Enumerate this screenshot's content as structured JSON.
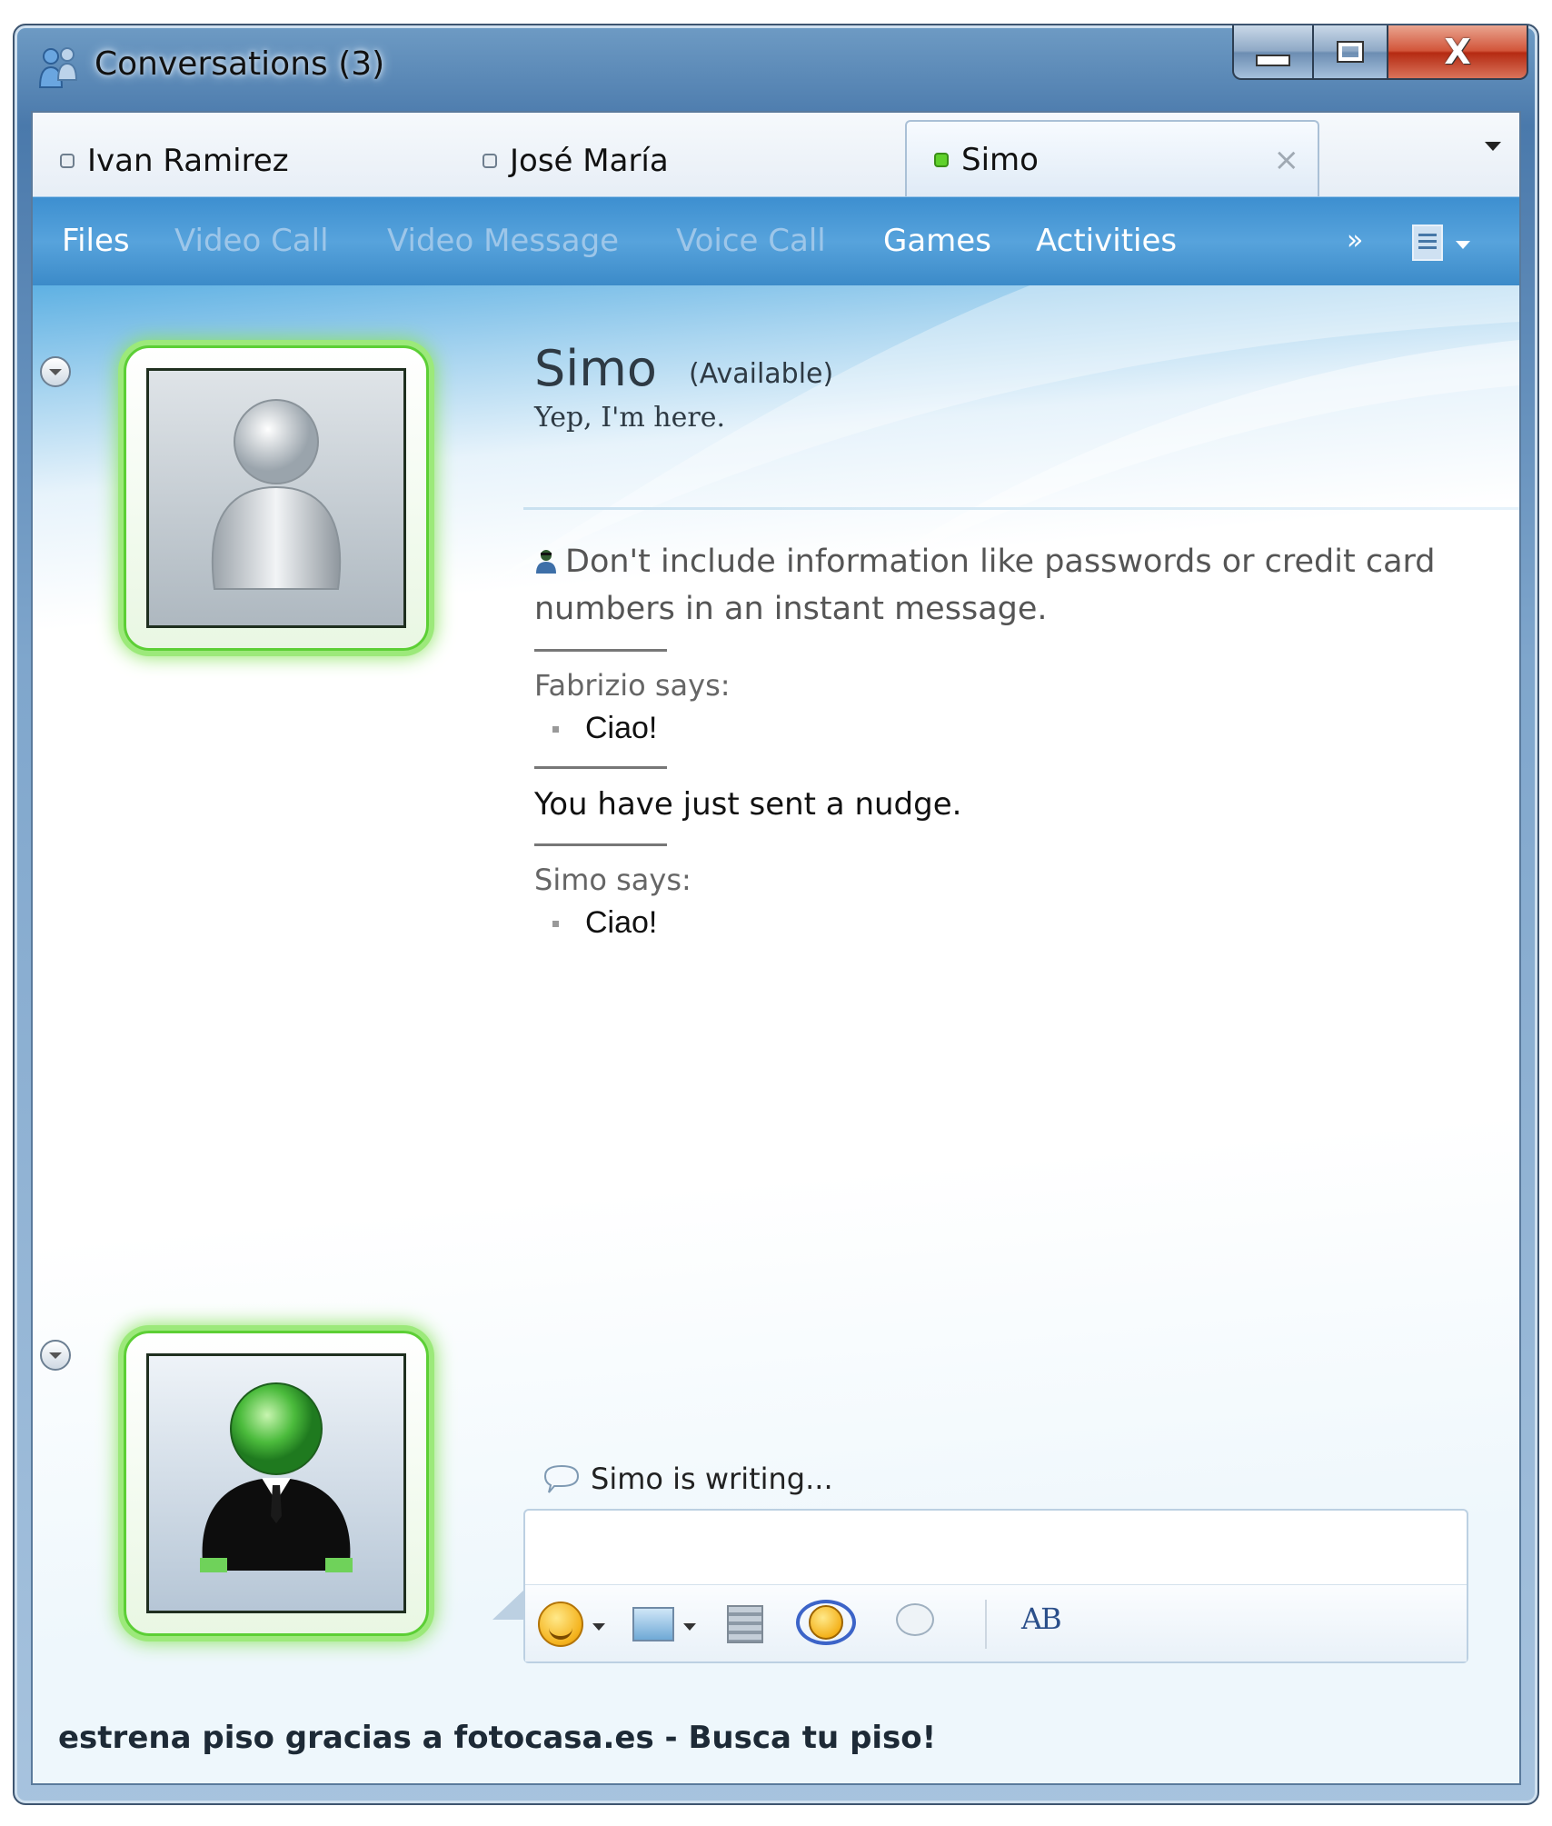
{
  "window": {
    "title": "Conversations (3)",
    "close_label": "X"
  },
  "tabs": [
    {
      "label": "Ivan Ramirez",
      "status": "offline"
    },
    {
      "label": "José María",
      "status": "offline"
    },
    {
      "label": "Simo",
      "status": "available",
      "active": true,
      "close_label": "×"
    }
  ],
  "toolbar": {
    "files": "Files",
    "video_call": "Video Call",
    "video_message": "Video Message",
    "voice_call": "Voice Call",
    "games": "Games",
    "activities": "Activities",
    "more": "»"
  },
  "contact": {
    "name": "Simo",
    "status": "(Available)",
    "personal_message": "Yep, I'm here."
  },
  "conversation": {
    "warning": "Don't include information like passwords or credit card numbers in an instant message.",
    "messages": [
      {
        "sender": "Fabrizio says:",
        "text": "Ciao!"
      },
      {
        "system": "You have just sent a nudge."
      },
      {
        "sender": "Simo says:",
        "text": "Ciao!"
      }
    ],
    "typing": "Simo is writing..."
  },
  "compose": {
    "value": "",
    "font_icon_label": "AB"
  },
  "footer": {
    "ad_text": "estrena piso gracias a fotocasa.es - Busca tu piso!"
  },
  "colors": {
    "toolbar": "#4d9ad6",
    "presence_available": "#5fd12b",
    "avatar_glow": "#89e35d"
  }
}
